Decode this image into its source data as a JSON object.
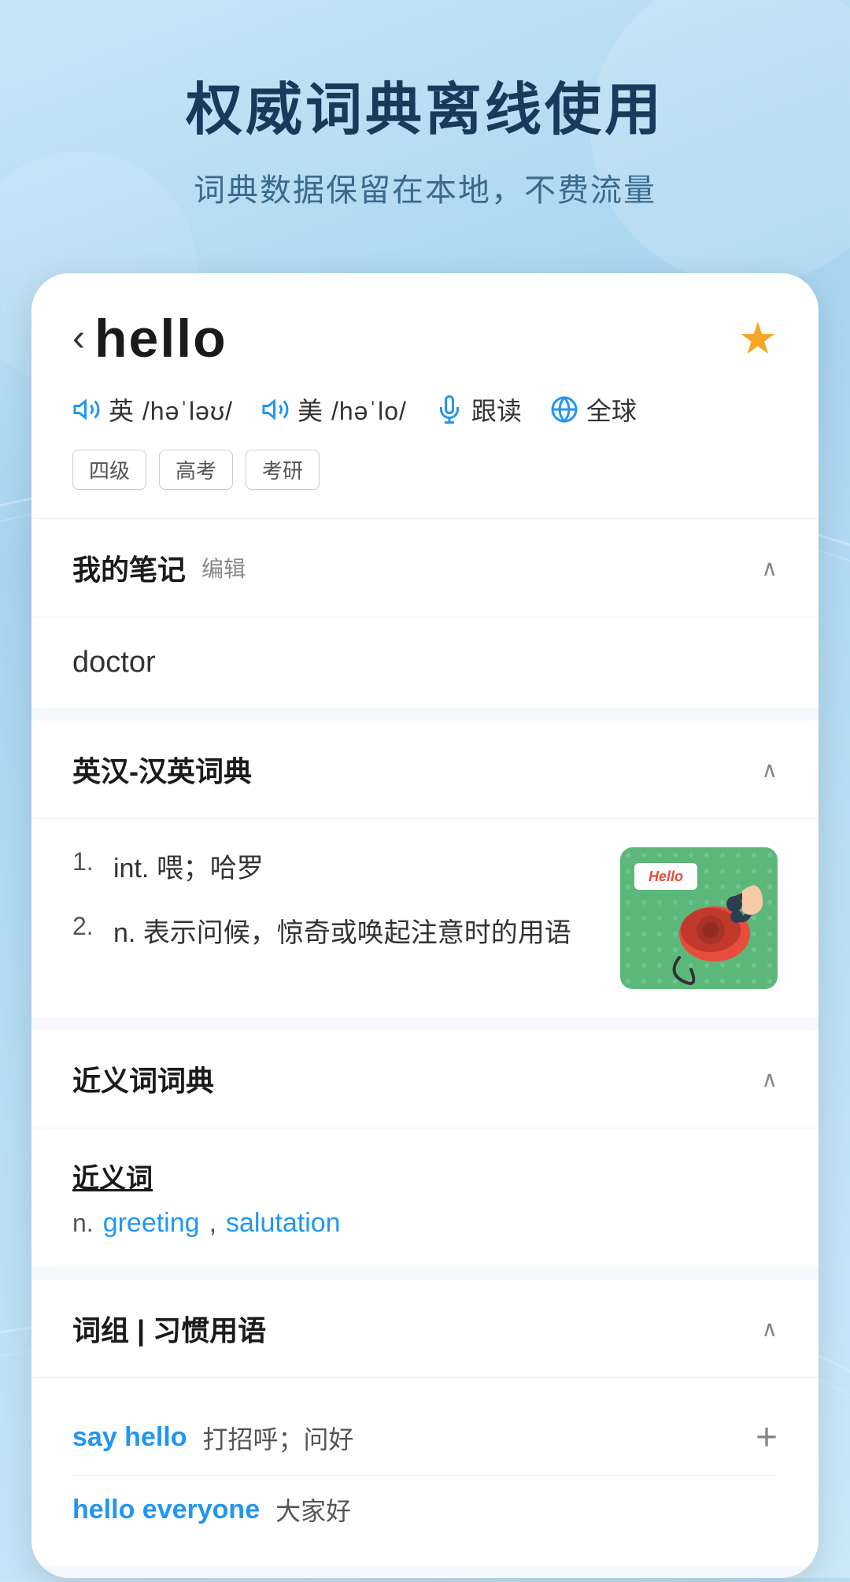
{
  "hero": {
    "title": "权威词典离线使用",
    "subtitle": "词典数据保留在本地，不费流量"
  },
  "word": {
    "back_symbol": "‹",
    "word": "hello",
    "star": "★",
    "uk_label": "英",
    "uk_pron": "/həˈləʊ/",
    "us_label": "美",
    "us_pron": "/həˈlo/",
    "follow_read": "跟读",
    "global": "全球",
    "tags": [
      "四级",
      "高考",
      "考研"
    ]
  },
  "notes_section": {
    "title": "我的笔记",
    "edit": "编辑",
    "content": "doctor",
    "collapsed": false
  },
  "dictionary_section": {
    "title": "英汉-汉英词典",
    "collapsed": false,
    "definitions": [
      {
        "num": "1.",
        "pos": "int.",
        "text": "喂；哈罗"
      },
      {
        "num": "2.",
        "pos": "n.",
        "text": "表示问候，惊奇或唤起注意时的用语"
      }
    ],
    "image_label": "Hello"
  },
  "synonyms_section": {
    "title": "近义词词典",
    "collapsed": false,
    "category": "近义词",
    "pos": "n.",
    "synonyms": [
      "greeting",
      "salutation"
    ]
  },
  "phrases_section": {
    "title": "词组 | 习惯用语",
    "collapsed": false,
    "phrases": [
      {
        "en": "say hello",
        "zh": "打招呼；问好",
        "has_add": true
      },
      {
        "en": "hello everyone",
        "zh": "大家好",
        "has_add": false
      }
    ]
  }
}
